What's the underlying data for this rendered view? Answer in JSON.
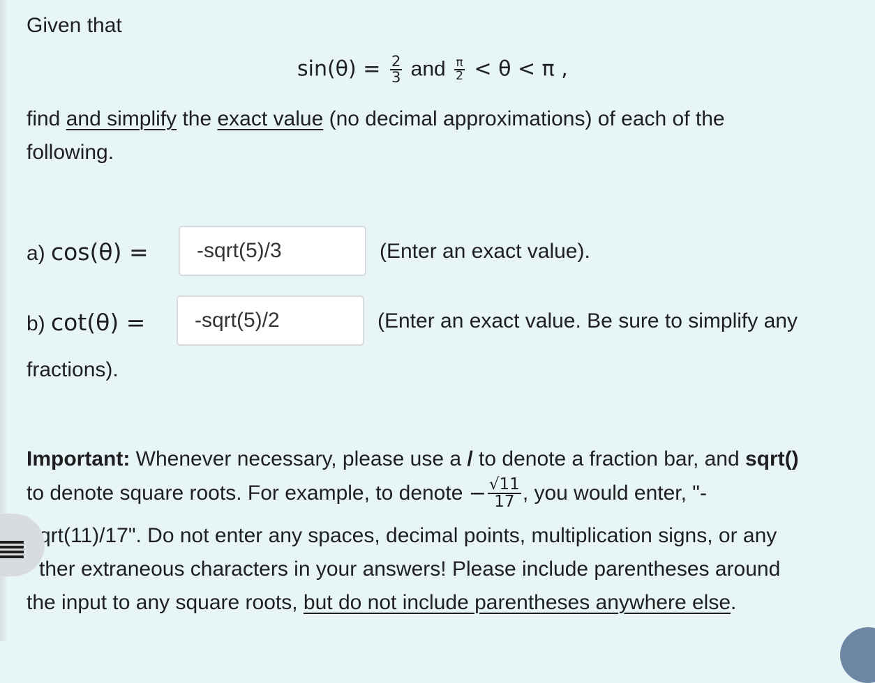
{
  "intro": {
    "given": "Given that",
    "equation": {
      "lhs": "sin(θ) = ",
      "sin_fraction": {
        "numerator": "2",
        "denominator": "3"
      },
      "and_word": " and ",
      "range_fraction": {
        "numerator": "π",
        "denominator": "2"
      },
      "range_rest": " < θ < π ,"
    },
    "find_prefix": "find ",
    "find_link1": "and simplify",
    "find_mid": " the ",
    "find_link2": "exact value",
    "find_suffix": " (no decimal approximations) of each of the",
    "find_line2": "following."
  },
  "part_a": {
    "label": "a) ",
    "func": "cos(θ) =",
    "input_value": "-sqrt(5)/3",
    "hint": "(Enter an exact value)."
  },
  "part_b": {
    "label": "b) ",
    "func": "cot(θ) =",
    "input_value": "-sqrt(5)/2",
    "hint": "(Enter an exact value. Be sure to simplify any",
    "hint_cont": "fractions)."
  },
  "important": {
    "bold_label": "Important:",
    "text1": " Whenever necessary, please use a ",
    "slash": "/",
    "text2": " to denote a fraction bar, and ",
    "sqrt_bold": "sqrt()",
    "line2_start": "to denote square roots. For example, to denote ",
    "example_neg": "−",
    "example_num": "√11",
    "example_den": "17",
    "line2_end": ", you would enter, \"-",
    "line3": "qrt(11)/17\". Do not enter any spaces, decimal points, multiplication signs, or any",
    "line4": "ther extraneous characters in your answers! Please include parentheses around",
    "line5_start": "the input to any square roots, ",
    "line5_link": "but do not include parentheses anywhere else",
    "line5_end": "."
  }
}
